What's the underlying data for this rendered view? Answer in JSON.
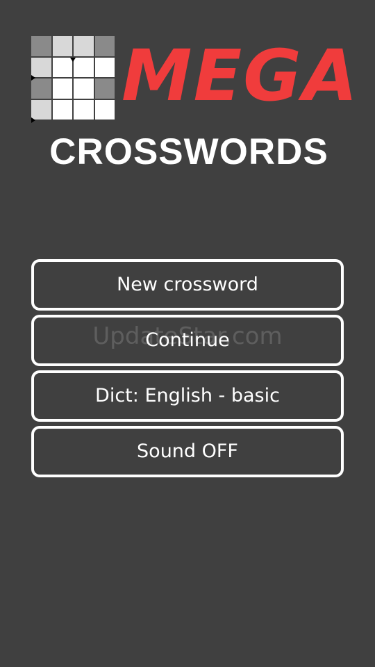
{
  "logo": {
    "mega_text": "MEGA",
    "crosswords_text": "CROSSWORDS",
    "mega_color": "#f03c3c",
    "background": "#404040",
    "grid_icon": "crossword-grid-icon"
  },
  "menu": {
    "items": [
      {
        "label": "New crossword"
      },
      {
        "label": "Continue"
      },
      {
        "label": "Dict: English - basic"
      },
      {
        "label": "Sound OFF"
      }
    ]
  },
  "watermark": {
    "text": "UpdateStar.com"
  }
}
